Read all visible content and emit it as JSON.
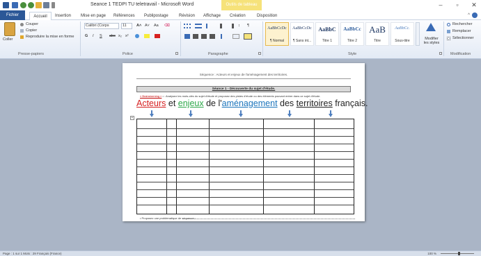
{
  "window": {
    "title": "Seance 1 TEDPI TU teletravail - Microsoft Word",
    "context_tab": "Outils de tableau",
    "controls": [
      "–",
      "▫",
      "✕"
    ]
  },
  "tabs": [
    "Fichier",
    "Accueil",
    "Insertion",
    "Mise en page",
    "Références",
    "Publipostage",
    "Révision",
    "Affichage",
    "Création",
    "Disposition"
  ],
  "ribbon": {
    "clipboard": {
      "paste": "Coller",
      "cut": "Couper",
      "copy": "Copier",
      "format_painter": "Reproduire la mise en forme",
      "group": "Presse-papiers"
    },
    "font": {
      "name": "Calibri (Corps",
      "size": "11",
      "group": "Police"
    },
    "paragraph": {
      "group": "Paragraphe"
    },
    "styles": {
      "items": [
        {
          "sample": "AaBbCcDc",
          "name": "¶ Normal"
        },
        {
          "sample": "AaBbCcDc",
          "name": "¶ Sans int..."
        },
        {
          "sample": "AaBbC",
          "name": "Titre 1"
        },
        {
          "sample": "AaBbCc",
          "name": "Titre 2"
        },
        {
          "sample": "AaB",
          "name": "Titre"
        },
        {
          "sample": "AaBbCc.",
          "name": "Sous-titre"
        }
      ],
      "change": "Modifier les styles",
      "group": "Style"
    },
    "editing": {
      "find": "Rechercher",
      "replace": "Remplacer",
      "select": "Sélectionner",
      "group": "Modification"
    }
  },
  "document": {
    "header": "Séquence : Acteurs et enjeux de l'aménagement des territoires.",
    "seance": "Séance 1 - Découverte du sujet d'étude.",
    "consigne_keyword": "« Brainstorming »",
    "consigne": "• : Analysez les mots-clés du sujet d'étude et proposez des pistes d'étude ou des éléments pouvant entrer dans ce sujet d'étude.",
    "title_parts": [
      {
        "text": "Acteurs",
        "style": "rouge"
      },
      {
        "text": " et ",
        "style": "plain"
      },
      {
        "text": "enjeux",
        "style": "vert"
      },
      {
        "text": " de l'",
        "style": "plain"
      },
      {
        "text": "aménagement",
        "style": "bleu"
      },
      {
        "text": " des ",
        "style": "plain"
      },
      {
        "text": "territoires",
        "style": "noir"
      },
      {
        "text": " français.",
        "style": "plain"
      }
    ],
    "table_handle": "+",
    "problematique": "• Proposez une problématique de séquence :"
  },
  "statusbar": {
    "text": "Page : 1 sur 1   Mots : 29   Français (France)",
    "zoom": "100 %"
  }
}
